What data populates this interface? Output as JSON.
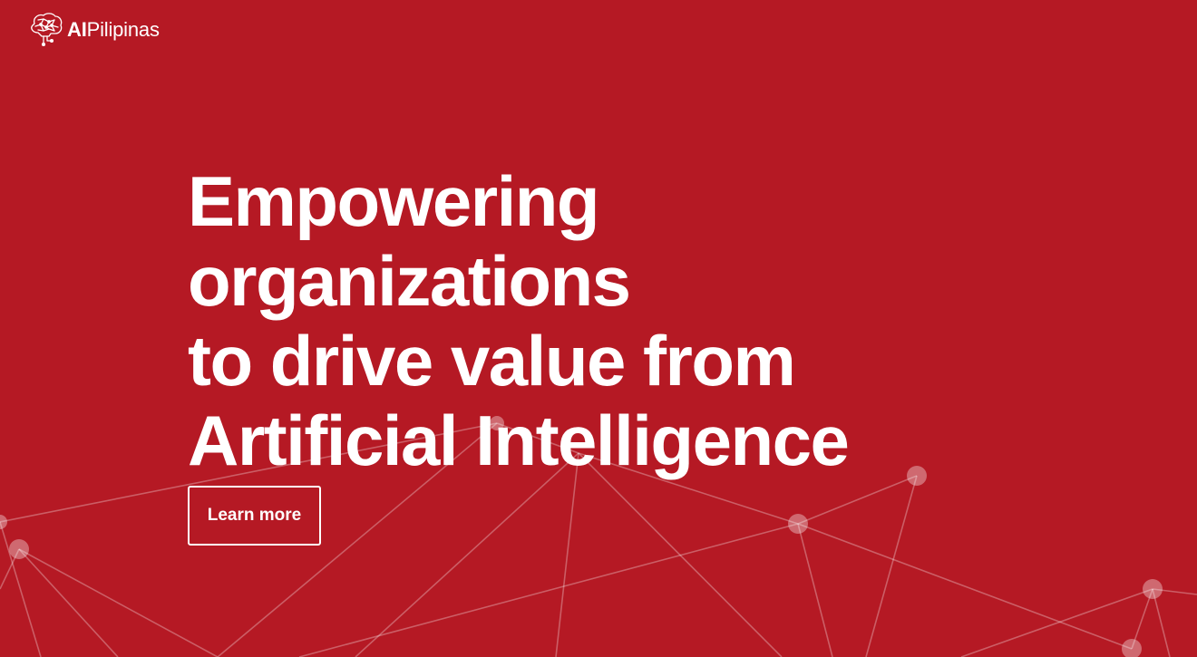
{
  "brand": {
    "name_bold": "AI",
    "name_regular": "Pilipinas",
    "logo_icon": "brain-circuit-icon"
  },
  "hero": {
    "headline_lines": [
      "Empowering",
      "organizations",
      "to drive value from",
      "Artificial Intelligence"
    ],
    "cta_label": "Learn more"
  },
  "colors": {
    "background": "#b51924",
    "text": "#ffffff"
  }
}
